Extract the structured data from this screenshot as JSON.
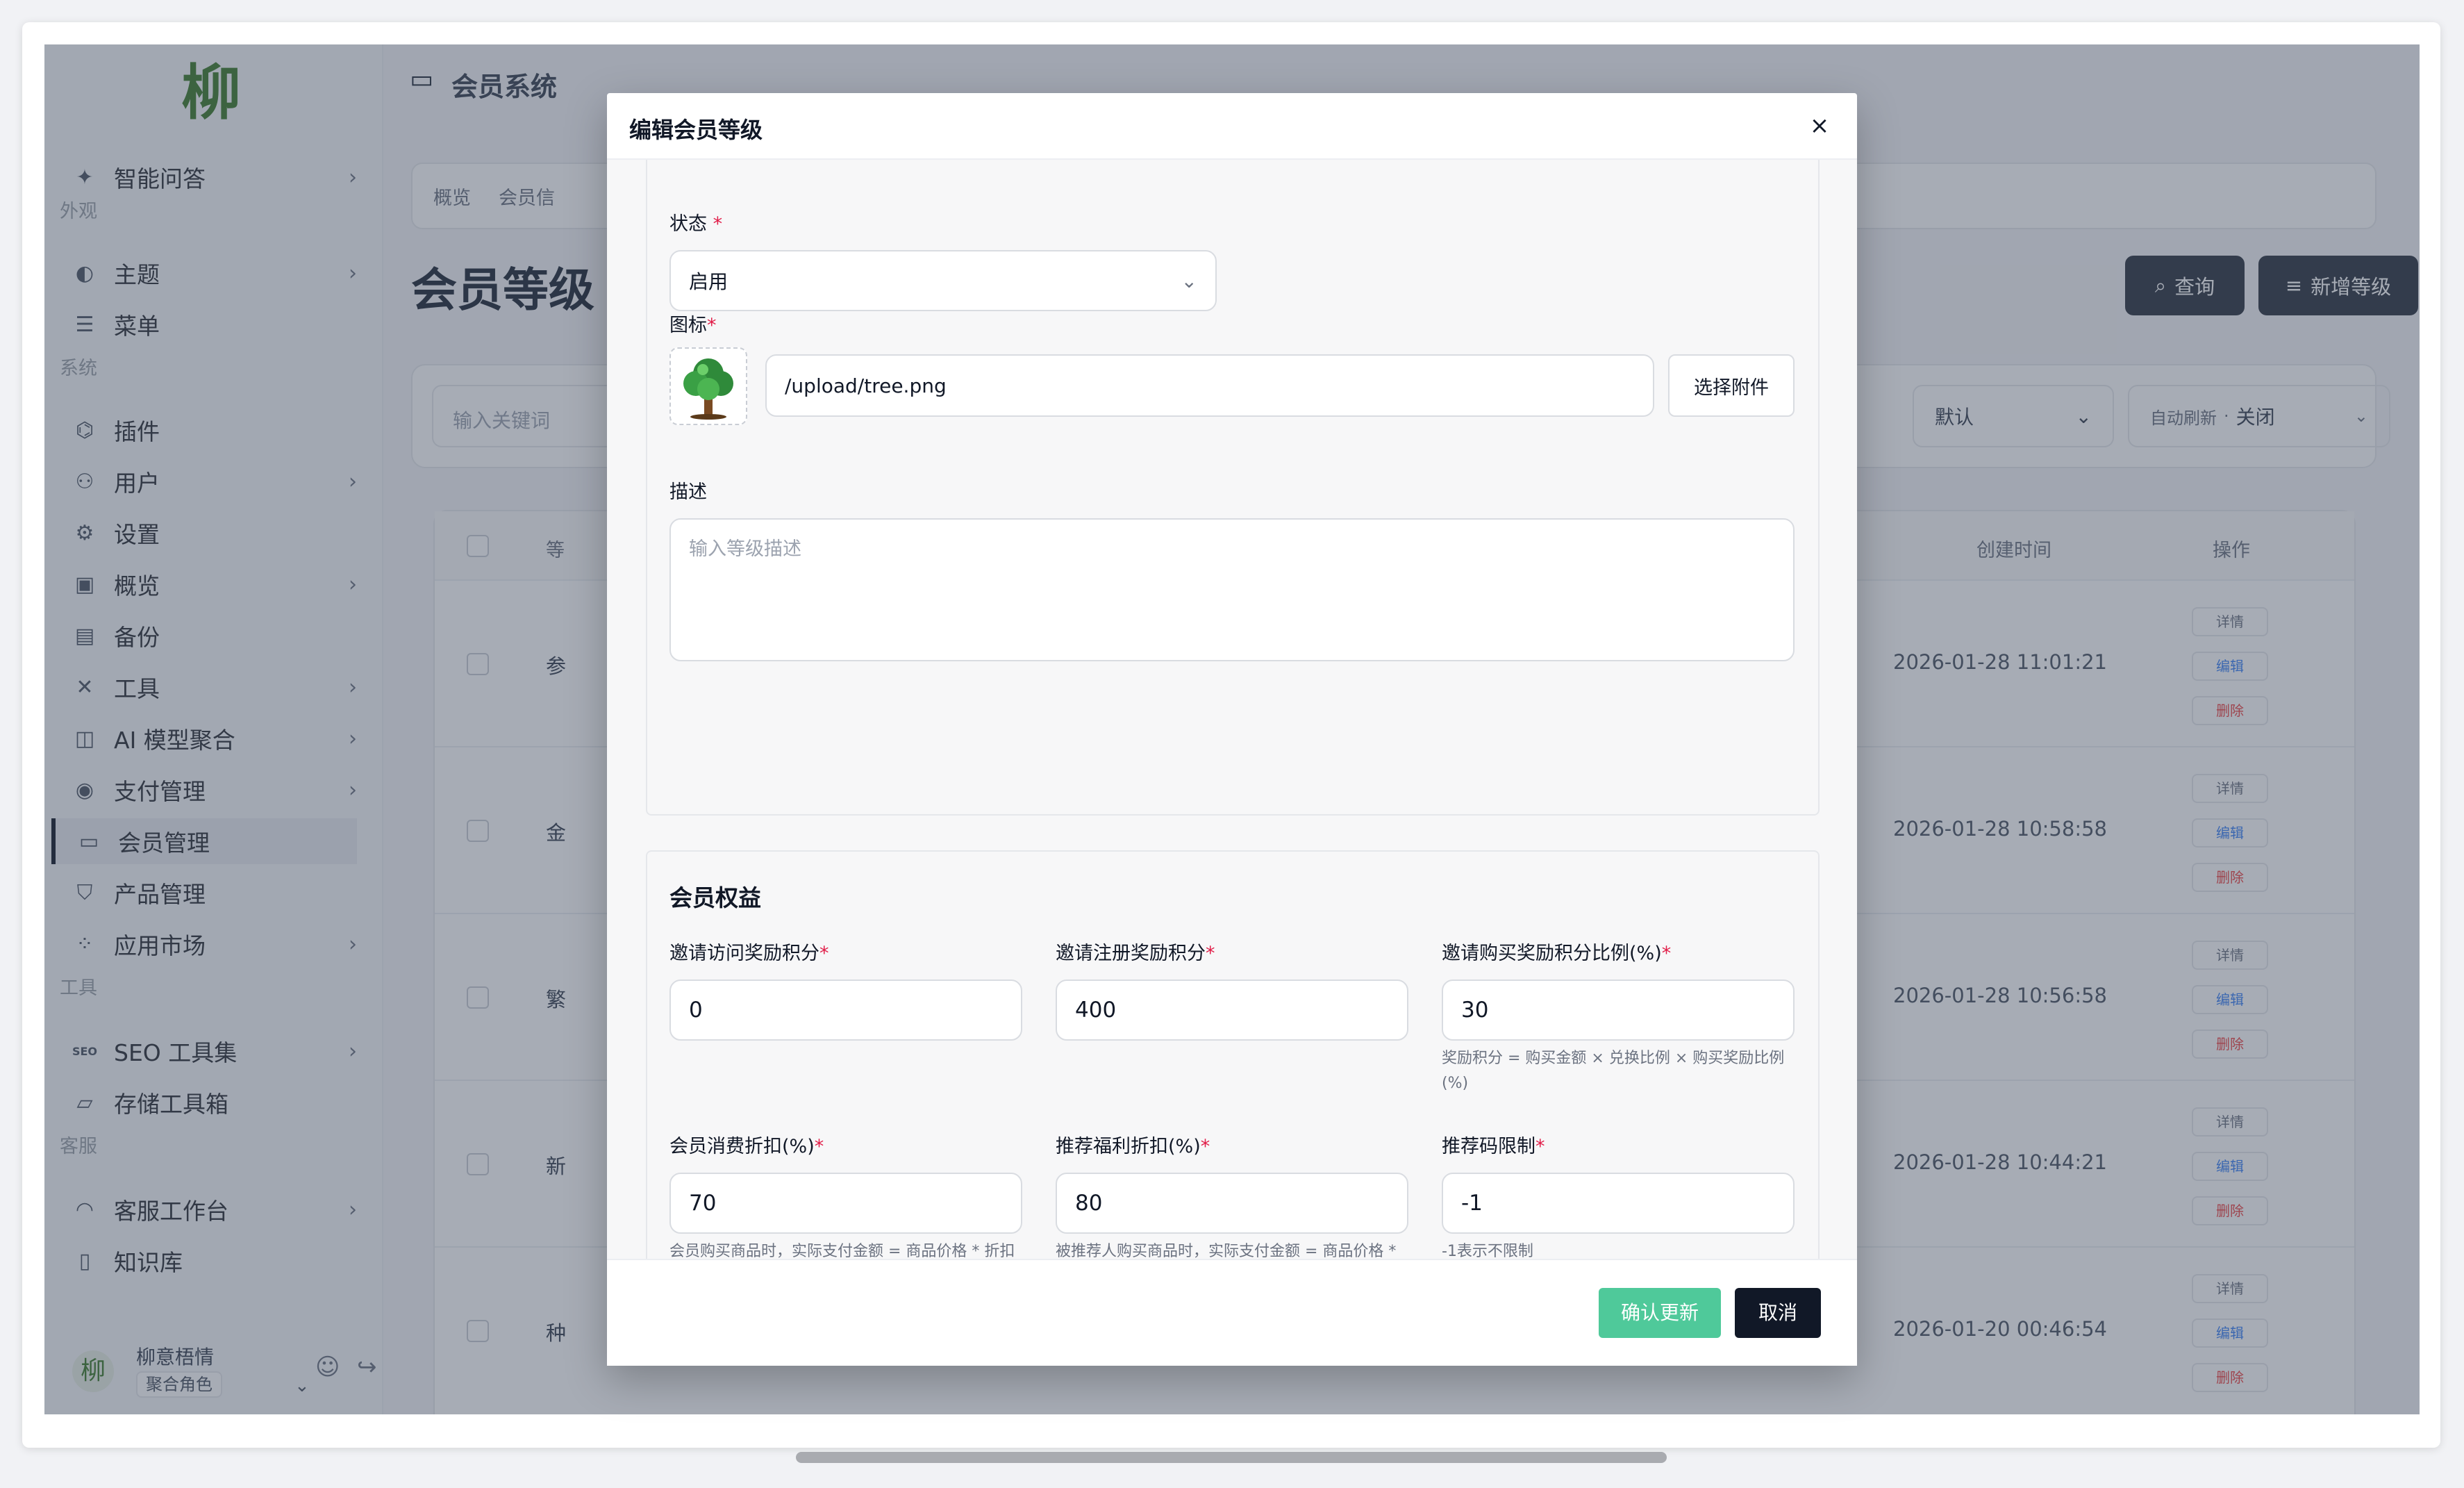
{
  "sidebar": {
    "logo_text": "柳",
    "items": [
      {
        "label": "智能问答",
        "icon": "sparkle-icon"
      },
      {
        "label": "主题",
        "icon": "palette-icon"
      },
      {
        "label": "菜单",
        "icon": "menu-icon"
      },
      {
        "label": "插件",
        "icon": "plugin-icon"
      },
      {
        "label": "用户",
        "icon": "user-icon"
      },
      {
        "label": "设置",
        "icon": "gear-icon"
      },
      {
        "label": "概览",
        "icon": "terminal-icon"
      },
      {
        "label": "备份",
        "icon": "backup-icon"
      },
      {
        "label": "工具",
        "icon": "tools-icon"
      },
      {
        "label": "AI 模型聚合",
        "icon": "robot-icon"
      },
      {
        "label": "支付管理",
        "icon": "payment-icon"
      },
      {
        "label": "会员管理",
        "icon": "member-icon"
      },
      {
        "label": "产品管理",
        "icon": "shield-icon"
      },
      {
        "label": "应用市场",
        "icon": "grid-icon"
      },
      {
        "label": "SEO 工具集",
        "icon": "seo-icon"
      },
      {
        "label": "存储工具箱",
        "icon": "folder-icon"
      },
      {
        "label": "客服工作台",
        "icon": "headset-icon"
      },
      {
        "label": "知识库",
        "icon": "book-icon"
      }
    ],
    "groups": {
      "appearance": "外观",
      "system": "系统",
      "tools": "工具",
      "service": "客服"
    },
    "user": {
      "name": "柳意梧情",
      "role": "聚合角色",
      "avatar": "柳"
    }
  },
  "topbar": {
    "title": "会员系统"
  },
  "breadcrumbs": [
    "概览",
    "会员信"
  ],
  "page": {
    "title": "会员等级",
    "query_button": "查询",
    "add_button": "新增等级"
  },
  "filter": {
    "keyword_placeholder": "输入关键词",
    "sort_value": "默认",
    "auto_refresh_label": "自动刷新",
    "auto_refresh_value": "关闭"
  },
  "table": {
    "headers": {
      "level": "等",
      "created": "创建时间",
      "actions": "操作"
    },
    "rows": [
      {
        "name": "参",
        "created": "2026-01-28 11:01:21"
      },
      {
        "name": "金",
        "created": "2026-01-28 10:58:58"
      },
      {
        "name": "繁",
        "created": "2026-01-28 10:56:58"
      },
      {
        "name": "新",
        "created": "2026-01-28 10:44:21"
      },
      {
        "name": "种",
        "created": "2026-01-20 00:46:54"
      }
    ],
    "actions": {
      "detail": "详情",
      "edit": "编辑",
      "delete": "删除"
    }
  },
  "modal": {
    "title": "编辑会员等级",
    "status_label": "状态",
    "status_value": "启用",
    "icon_label": "图标",
    "icon_path": "/upload/tree.png",
    "choose_attachment": "选择附件",
    "description_label": "描述",
    "description_placeholder": "输入等级描述",
    "benefits_title": "会员权益",
    "fields": [
      {
        "label": "邀请访问奖励积分",
        "value": "0",
        "hint": ""
      },
      {
        "label": "邀请注册奖励积分",
        "value": "400",
        "hint": ""
      },
      {
        "label": "邀请购买奖励积分比例(%)",
        "value": "30",
        "hint": "奖励积分 = 购买金额 × 兑换比例 × 购买奖励比例(%)"
      },
      {
        "label": "会员消费折扣(%)",
        "value": "70",
        "hint": "会员购买商品时，实际支付金额 = 商品价格 * 折扣"
      },
      {
        "label": "推荐福利折扣(%)",
        "value": "80",
        "hint": "被推荐人购买商品时，实际支付金额 = 商品价格 * 折扣"
      },
      {
        "label": "推荐码限制",
        "value": "-1",
        "hint": "-1表示不限制"
      }
    ],
    "confirm_button": "确认更新",
    "cancel_button": "取消"
  },
  "colors": {
    "accent": "#4fc99a",
    "dark": "#111827",
    "required": "#e11d48"
  }
}
